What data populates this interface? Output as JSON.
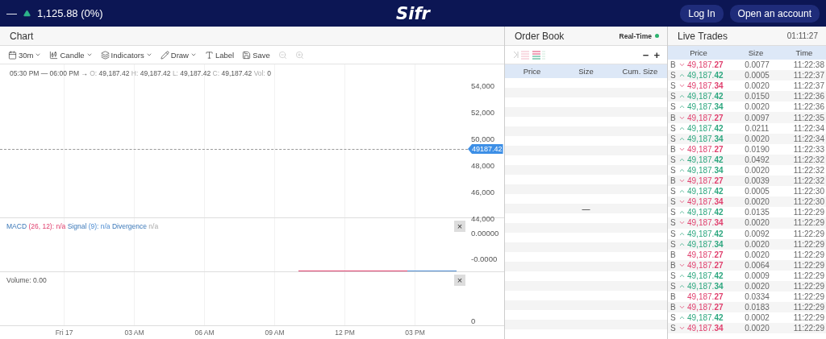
{
  "top_bar": {
    "dash": "—",
    "index_change": "1,125.88 (0%)",
    "logo": "Sifr",
    "buttons": [
      "Log In",
      "Open an account"
    ]
  },
  "chart": {
    "title": "Chart",
    "toolbar": [
      {
        "kind": "menu",
        "label": "30m"
      },
      {
        "kind": "menu",
        "label": "Candle"
      },
      {
        "kind": "menu",
        "label": "Indicators"
      },
      {
        "kind": "menu",
        "label": "Draw"
      },
      {
        "kind": "button",
        "label": "Label"
      },
      {
        "kind": "button",
        "label": "Save"
      },
      {
        "kind": "icon",
        "disabled": true
      },
      {
        "kind": "icon",
        "disabled": true
      }
    ],
    "info": {
      "range": "05:30 PM — 06:00 PM →",
      "ohlc": [
        {
          "label": "O:",
          "value": "49,187.42"
        },
        {
          "label": "H:",
          "value": "49,187.42"
        },
        {
          "label": "L:",
          "value": "49,187.42"
        },
        {
          "label": "C:",
          "value": "49,187.42"
        },
        {
          "label": "Vol:",
          "value": "0"
        }
      ]
    },
    "price_axis": [
      "54,000",
      "52,000",
      "50,000",
      "48,000",
      "46,000",
      "44,000"
    ],
    "price_tag": "49187.42",
    "macd": {
      "legend": [
        {
          "name": "MACD",
          "params": "(26, 12):",
          "value": "n/a"
        },
        {
          "name": "Signal",
          "params": "(9):",
          "value": "n/a"
        },
        {
          "name": "Divergence",
          "value": "n/a"
        }
      ],
      "axis": [
        "0.00000",
        "-0.0000"
      ],
      "close": "×"
    },
    "volume": {
      "legend": "Volume: 0.00",
      "axis": [
        "0"
      ],
      "close": "×"
    },
    "time_axis": [
      "Fri 17",
      "03 AM",
      "06 AM",
      "09 AM",
      "12 PM",
      "03 PM"
    ]
  },
  "order_book": {
    "title": "Order Book",
    "status": "Real-Time",
    "live": true,
    "zoom_buttons": [
      "−",
      "+"
    ],
    "columns": [
      "Price",
      "Size",
      "Cum. Size"
    ],
    "empty_mark": "—"
  },
  "live_trades": {
    "title": "Live Trades",
    "clock": "01:11:27",
    "columns": [
      "Price",
      "Size",
      "Time"
    ],
    "rows": [
      {
        "side": "B",
        "kind": "down",
        "price": "49,187.**27**",
        "color": "#e0406e",
        "size": "0.0077",
        "time": "11:22:38"
      },
      {
        "side": "S",
        "kind": "up",
        "price": "49,187.**42**",
        "color": "#2da77f",
        "size": "0.0005",
        "time": "11:22:37"
      },
      {
        "side": "S",
        "kind": "down",
        "price": "49,187.**34**",
        "color": "#e0406e",
        "size": "0.0020",
        "time": "11:22:37"
      },
      {
        "side": "S",
        "kind": "up",
        "price": "49,187.**42**",
        "color": "#2da77f",
        "size": "0.0150",
        "time": "11:22:36"
      },
      {
        "side": "S",
        "kind": "up",
        "price": "49,187.**34**",
        "color": "#2da77f",
        "size": "0.0020",
        "time": "11:22:36"
      },
      {
        "side": "B",
        "kind": "down",
        "price": "49,187.**27**",
        "color": "#e0406e",
        "size": "0.0097",
        "time": "11:22:35"
      },
      {
        "side": "S",
        "kind": "up",
        "price": "49,187.**42**",
        "color": "#2da77f",
        "size": "0.0211",
        "time": "11:22:34"
      },
      {
        "side": "S",
        "kind": "up",
        "price": "49,187.**34**",
        "color": "#2da77f",
        "size": "0.0020",
        "time": "11:22:34"
      },
      {
        "side": "B",
        "kind": "down",
        "price": "49,187.**27**",
        "color": "#e0406e",
        "size": "0.0190",
        "time": "11:22:33"
      },
      {
        "side": "S",
        "kind": "up",
        "price": "49,187.**42**",
        "color": "#2da77f",
        "size": "0.0492",
        "time": "11:22:32"
      },
      {
        "side": "S",
        "kind": "up",
        "price": "49,187.**34**",
        "color": "#2da77f",
        "size": "0.0020",
        "time": "11:22:32"
      },
      {
        "side": "B",
        "kind": "down",
        "price": "49,187.**27**",
        "color": "#e0406e",
        "size": "0.0039",
        "time": "11:22:32"
      },
      {
        "side": "S",
        "kind": "up",
        "price": "49,187.**42**",
        "color": "#2da77f",
        "size": "0.0005",
        "time": "11:22:30"
      },
      {
        "side": "S",
        "kind": "down",
        "price": "49,187.**34**",
        "color": "#e0406e",
        "size": "0.0020",
        "time": "11:22:30"
      },
      {
        "side": "S",
        "kind": "up",
        "price": "49,187.**42**",
        "color": "#2da77f",
        "size": "0.0135",
        "time": "11:22:29"
      },
      {
        "side": "S",
        "kind": "down",
        "price": "49,187.**34**",
        "color": "#e0406e",
        "size": "0.0020",
        "time": "11:22:29"
      },
      {
        "side": "S",
        "kind": "up",
        "price": "49,187.**42**",
        "color": "#2da77f",
        "size": "0.0092",
        "time": "11:22:29"
      },
      {
        "side": "S",
        "kind": "up",
        "price": "49,187.**34**",
        "color": "#2da77f",
        "size": "0.0020",
        "time": "11:22:29"
      },
      {
        "side": "B",
        "kind": "plain",
        "price": "49,187.**27**",
        "color": "#e0406e",
        "size": "0.0020",
        "time": "11:22:29"
      },
      {
        "side": "B",
        "kind": "down",
        "price": "49,187.**27**",
        "color": "#e0406e",
        "size": "0.0064",
        "time": "11:22:29"
      },
      {
        "side": "S",
        "kind": "up",
        "price": "49,187.**42**",
        "color": "#2da77f",
        "size": "0.0009",
        "time": "11:22:29"
      },
      {
        "side": "S",
        "kind": "up",
        "price": "49,187.**34**",
        "color": "#2da77f",
        "size": "0.0020",
        "time": "11:22:29"
      },
      {
        "side": "B",
        "kind": "plain",
        "price": "49,187.**27**",
        "color": "#e0406e",
        "size": "0.0334",
        "time": "11:22:29"
      },
      {
        "side": "B",
        "kind": "down",
        "price": "49,187.**27**",
        "color": "#e0406e",
        "size": "0.0183",
        "time": "11:22:29"
      },
      {
        "side": "S",
        "kind": "up",
        "price": "49,187.**42**",
        "color": "#2da77f",
        "size": "0.0002",
        "time": "11:22:29"
      },
      {
        "side": "S",
        "kind": "down",
        "price": "49,187.**34**",
        "color": "#e0406e",
        "size": "0.0020",
        "time": "11:22:29"
      }
    ]
  }
}
